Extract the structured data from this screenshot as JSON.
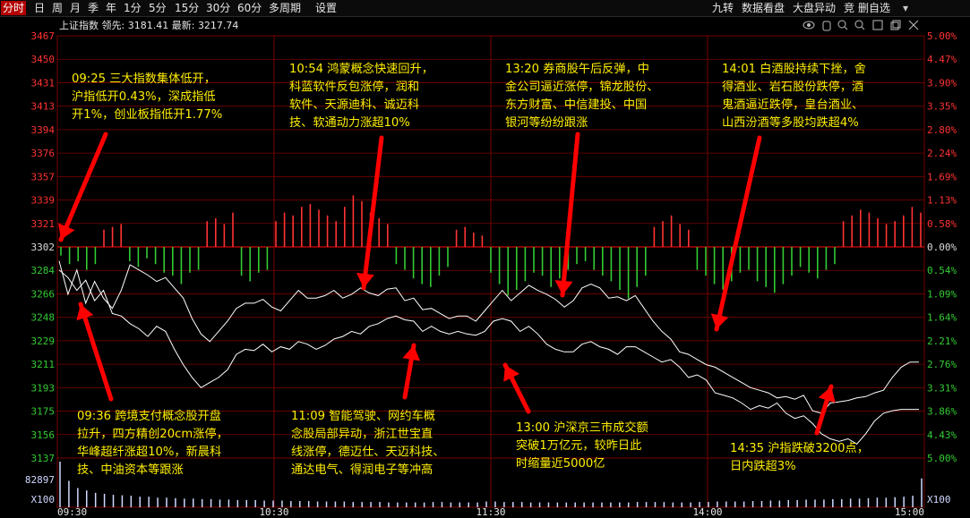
{
  "toolbar": {
    "left_items": [
      "分时",
      "日",
      "周",
      "月",
      "季",
      "年",
      "1分",
      "5分",
      "15分",
      "30分",
      "60分",
      "多周期",
      "设置"
    ],
    "right_items": [
      "九转",
      "数据看盘",
      "大盘异动",
      "竞",
      "删自选"
    ]
  },
  "info": {
    "index_name": "上证指数",
    "leader_label": "领先:",
    "leader_value": "3181.41",
    "latest_label": "最新:",
    "latest_value": "3217.74"
  },
  "chart_data": {
    "type": "line",
    "prev_close": 3302,
    "y_ticks_left": [
      "3467",
      "3450",
      "3431",
      "3413",
      "3394",
      "3376",
      "3357",
      "3339",
      "3321",
      "3302",
      "3284",
      "3266",
      "3248",
      "3229",
      "3211",
      "3193",
      "3175",
      "3156",
      "3137"
    ],
    "y_ticks_right": [
      "5.00%",
      "4.47%",
      "3.90%",
      "3.35%",
      "2.80%",
      "2.24%",
      "1.69%",
      "1.13%",
      "0.58%",
      "0.00%",
      "0.54%",
      "1.09%",
      "1.64%",
      "2.21%",
      "2.76%",
      "3.31%",
      "3.86%",
      "4.43%",
      "5.00%"
    ],
    "x_ticks": [
      "09:30",
      "10:30",
      "11:30",
      "14:00",
      "15:00"
    ],
    "volume_max_label": "82897",
    "volume_unit": "X100",
    "series": [
      {
        "color": "#ffffff",
        "values": [
          3291,
          3265,
          3284,
          3258,
          3275,
          3262,
          3254,
          3268,
          3288,
          3284,
          3280,
          3275,
          3278,
          3270,
          3262,
          3246,
          3234,
          3228,
          3236,
          3244,
          3254,
          3258,
          3258,
          3261,
          3255,
          3252,
          3260,
          3268,
          3262,
          3262,
          3264,
          3268,
          3262,
          3265,
          3270,
          3266,
          3264,
          3269,
          3270,
          3260,
          3262,
          3253,
          3254,
          3250,
          3246,
          3248,
          3248,
          3244,
          3252,
          3260,
          3268,
          3260,
          3266,
          3272,
          3268,
          3265,
          3261,
          3255,
          3260,
          3270,
          3273,
          3270,
          3262,
          3263,
          3260,
          3264,
          3254,
          3244,
          3236,
          3230,
          3220,
          3218,
          3214,
          3210,
          3208,
          3204,
          3200,
          3196,
          3192,
          3190,
          3188,
          3184,
          3185,
          3183,
          3186,
          3174,
          3172,
          3180,
          3181,
          3182,
          3184,
          3185,
          3188,
          3190,
          3200,
          3208,
          3212,
          3212
        ]
      },
      {
        "color": "#ffffff",
        "values": [
          3284,
          3278,
          3268,
          3276,
          3260,
          3268,
          3250,
          3248,
          3242,
          3238,
          3232,
          3240,
          3236,
          3222,
          3210,
          3200,
          3192,
          3196,
          3200,
          3206,
          3218,
          3222,
          3221,
          3226,
          3220,
          3224,
          3222,
          3228,
          3226,
          3222,
          3225,
          3230,
          3232,
          3236,
          3234,
          3240,
          3242,
          3246,
          3248,
          3245,
          3244,
          3236,
          3240,
          3236,
          3234,
          3236,
          3234,
          3233,
          3236,
          3244,
          3246,
          3244,
          3236,
          3240,
          3234,
          3226,
          3222,
          3220,
          3220,
          3226,
          3228,
          3224,
          3222,
          3218,
          3224,
          3224,
          3220,
          3216,
          3212,
          3214,
          3208,
          3200,
          3202,
          3198,
          3188,
          3186,
          3184,
          3180,
          3175,
          3178,
          3176,
          3180,
          3172,
          3168,
          3170,
          3164,
          3156,
          3152,
          3150,
          3152,
          3148,
          3156,
          3166,
          3172,
          3174,
          3175,
          3175,
          3175
        ]
      }
    ],
    "diff_bars": [
      -3,
      -6,
      -5,
      -8,
      -6,
      6,
      7,
      8,
      -5,
      -7,
      -4,
      -6,
      -9,
      -10,
      -13,
      -9,
      -8,
      9,
      10,
      8,
      12,
      -10,
      -12,
      -9,
      -8,
      9,
      12,
      11,
      14,
      15,
      13,
      11,
      9,
      14,
      18,
      16,
      12,
      10,
      8,
      -6,
      -8,
      -11,
      -13,
      -14,
      -10,
      -7,
      6,
      7,
      5,
      4,
      -9,
      -13,
      -17,
      -15,
      -12,
      -9,
      -10,
      -14,
      -11,
      -8,
      -6,
      -5,
      -8,
      -10,
      -12,
      -15,
      -18,
      -14,
      -10,
      7,
      9,
      11,
      8,
      6,
      -8,
      -10,
      -13,
      -15,
      -12,
      -9,
      -8,
      -12,
      -14,
      -16,
      -13,
      -10,
      -7,
      -9,
      -11,
      -8,
      -6,
      9,
      11,
      13,
      12,
      10,
      8,
      9,
      11,
      14,
      12
    ],
    "volume": [
      95,
      55,
      40,
      35,
      30,
      28,
      26,
      25,
      24,
      22,
      22,
      20,
      20,
      19,
      18,
      18,
      17,
      17,
      16,
      16,
      15,
      15,
      15,
      14,
      14,
      14,
      13,
      13,
      13,
      12,
      12,
      12,
      12,
      11,
      11,
      11,
      11,
      10,
      10,
      10,
      10,
      10,
      11,
      11,
      10,
      10,
      10,
      10,
      12,
      12,
      11,
      11,
      11,
      10,
      10,
      10,
      10,
      10,
      10,
      10,
      10,
      10,
      10,
      10,
      10,
      11,
      11,
      11,
      11,
      10,
      10,
      10,
      11,
      11,
      12,
      12,
      12,
      12,
      13,
      13,
      14,
      14,
      15,
      15,
      16,
      16,
      16,
      17,
      17,
      18,
      18,
      19,
      20,
      20,
      21,
      22,
      24,
      60
    ]
  },
  "annotations": [
    {
      "text": "09:25 三大指数集体低开，\n沪指低开0.43%，深成指低\n开1%，创业板指低开1.77%"
    },
    {
      "text": "10:54 鸿蒙概念快速回升，\n科蓝软件反包涨停，润和\n软件、天源迪科、诚迈科\n技、软通动力涨超10%"
    },
    {
      "text": "13:20 券商股午后反弹，中\n金公司逼近涨停，锦龙股份、\n东方财富、中信建投、中国\n银河等纷纷跟涨"
    },
    {
      "text": "14:01 白酒股持续下挫，舍\n得酒业、岩石股份跌停，酒\n鬼酒逼近跌停，皇台酒业、\n山西汾酒等多股均跌超4%"
    },
    {
      "text": "09:36 跨境支付概念股开盘\n拉升，四方精创20cm涨停，\n华峰超纤涨超10%，新晨科\n技、中油资本等跟涨"
    },
    {
      "text": "11:09 智能驾驶、网约车概\n念股局部异动，浙江世宝直\n线涨停，德迈仕、天迈科技、\n通达电气、得润电子等冲高"
    },
    {
      "text": "13:00 沪深京三市成交额\n突破1万亿元，较昨日此\n时缩量近5000亿"
    },
    {
      "text": "14:35 沪指跌破3200点，\n日内跌超3%"
    }
  ],
  "colors": {
    "up": "#ff3333",
    "down": "#33cc33",
    "grid": "#7a0000",
    "grid_dash": "#5a0000",
    "annotation": "#ffee00",
    "arrow": "#ff0000",
    "volume": "#cfd8ff"
  }
}
